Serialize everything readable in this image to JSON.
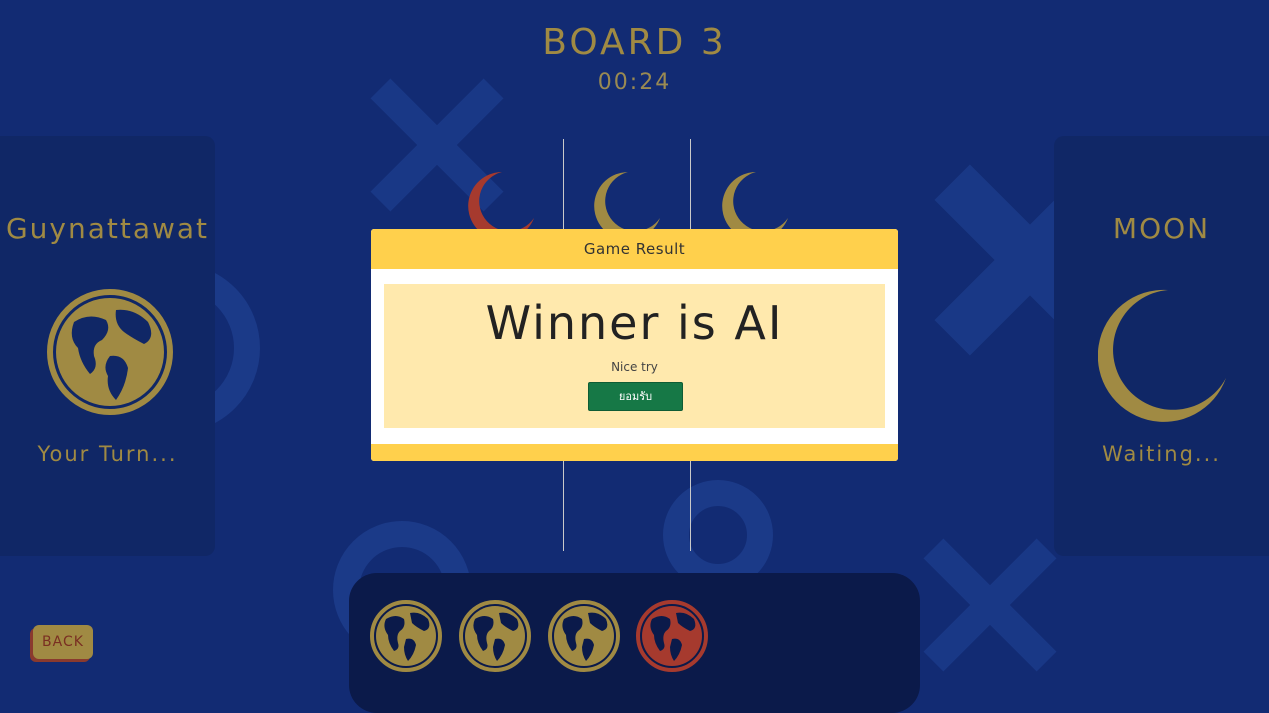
{
  "board": {
    "title": "BOARD 3",
    "timer": "00:24"
  },
  "players": {
    "left": {
      "name": "Guynattawat",
      "status": "Your Turn...",
      "icon": "globe-icon"
    },
    "right": {
      "name": "MOON",
      "status": "Waiting...",
      "icon": "moon-icon"
    }
  },
  "modal": {
    "header": "Game Result",
    "winner": "Winner is AI",
    "subtitle": "Nice try",
    "accept_label": "ยอมรับ"
  },
  "controls": {
    "back_label": "BACK"
  },
  "colors": {
    "background": "#122b73",
    "gold": "#a08a43",
    "red": "#a63a2e",
    "modal_accent": "#ffd04c",
    "accept_green": "#167846"
  }
}
